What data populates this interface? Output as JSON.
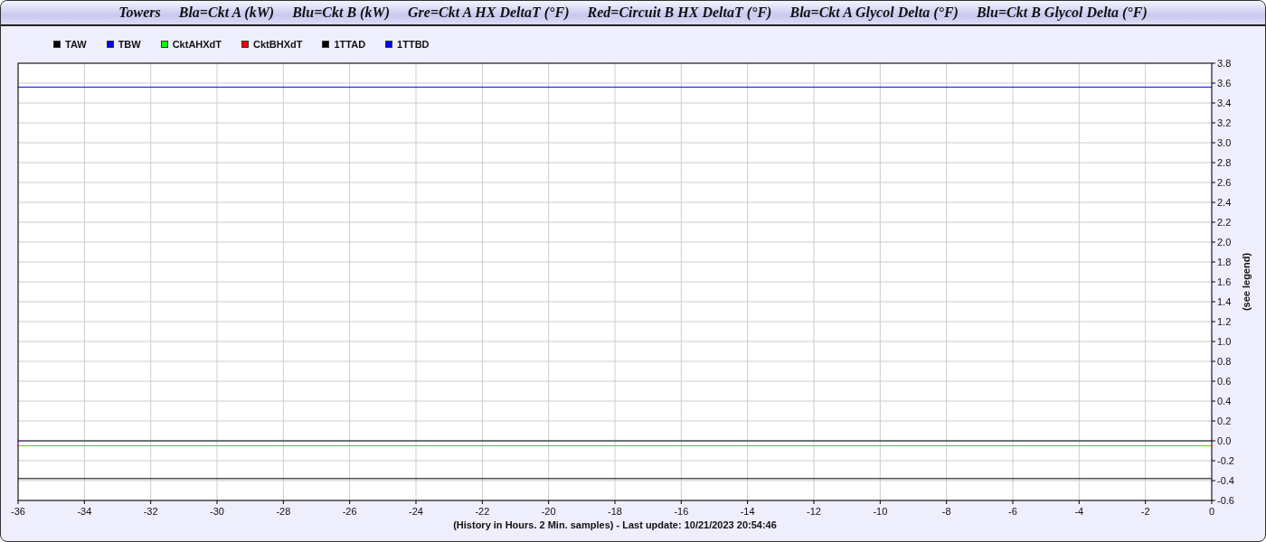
{
  "title_bar": {
    "segments": [
      "Towers",
      "Bla=Ckt A (kW)",
      "Blu=Ckt B (kW)",
      "Gre=Ckt A HX DeltaT (°F)",
      "Red=Circuit B HX DeltaT (°F)",
      "Bla=Ckt A Glycol Delta (°F)",
      "Blu=Ckt B Glycol Delta (°F)"
    ]
  },
  "chart": {
    "chart_data": {
      "type": "line",
      "xlabel": "(History in Hours. 2 Min. samples) - Last update: 10/21/2023 20:54:46",
      "ylabel": "(see legend)",
      "x": [
        -36,
        0
      ],
      "series": [
        {
          "name": "TAW",
          "color": "#000000",
          "values": [
            -0.38,
            -0.38
          ]
        },
        {
          "name": "TBW",
          "color": "#0000ff",
          "values": [
            null,
            null
          ]
        },
        {
          "name": "CktAHXdT",
          "color": "#00ff00",
          "values": [
            -0.05,
            -0.05
          ]
        },
        {
          "name": "CktBHXdT",
          "color": "#ff0000",
          "values": [
            null,
            null
          ]
        },
        {
          "name": "1TTAD",
          "color": "#000000",
          "values": [
            0.0,
            0.0
          ]
        },
        {
          "name": "1TTBD",
          "color": "#0000ff",
          "values": [
            3.56,
            3.56
          ]
        }
      ],
      "grid": true,
      "xlim": [
        -36,
        0
      ],
      "ylim": [
        -0.6,
        3.8
      ],
      "xticks": [
        -36,
        -34,
        -32,
        -30,
        -28,
        -26,
        -24,
        -22,
        -20,
        -18,
        -16,
        -14,
        -12,
        -10,
        -8,
        -6,
        -4,
        -2,
        0
      ],
      "yticks": [
        {
          "value": 3.8,
          "label": "3.8"
        },
        {
          "value": 3.6,
          "label": "3.6"
        },
        {
          "value": 3.4,
          "label": "3.4"
        },
        {
          "value": 3.2,
          "label": "3.2"
        },
        {
          "value": 3.0,
          "label": "3.0"
        },
        {
          "value": 2.8,
          "label": "2.8"
        },
        {
          "value": 2.6,
          "label": "2.6"
        },
        {
          "value": 2.4,
          "label": "2.4"
        },
        {
          "value": 2.2,
          "label": "2.2"
        },
        {
          "value": 2.0,
          "label": "2.0"
        },
        {
          "value": 1.8,
          "label": "1.8"
        },
        {
          "value": 1.6,
          "label": "1.6"
        },
        {
          "value": 1.4,
          "label": "1.4"
        },
        {
          "value": 1.2,
          "label": "1.2"
        },
        {
          "value": 1.0,
          "label": "1.0"
        },
        {
          "value": 0.8,
          "label": "0.8"
        },
        {
          "value": 0.6,
          "label": "0.6"
        },
        {
          "value": 0.4,
          "label": "0.4"
        },
        {
          "value": 0.2,
          "label": "0.2"
        },
        {
          "value": 0.0,
          "label": "0.0"
        },
        {
          "value": -0.2,
          "label": "-0.2"
        },
        {
          "value": -0.4,
          "label": "-0.4"
        },
        {
          "value": -0.6,
          "label": "-0.6"
        }
      ]
    }
  }
}
